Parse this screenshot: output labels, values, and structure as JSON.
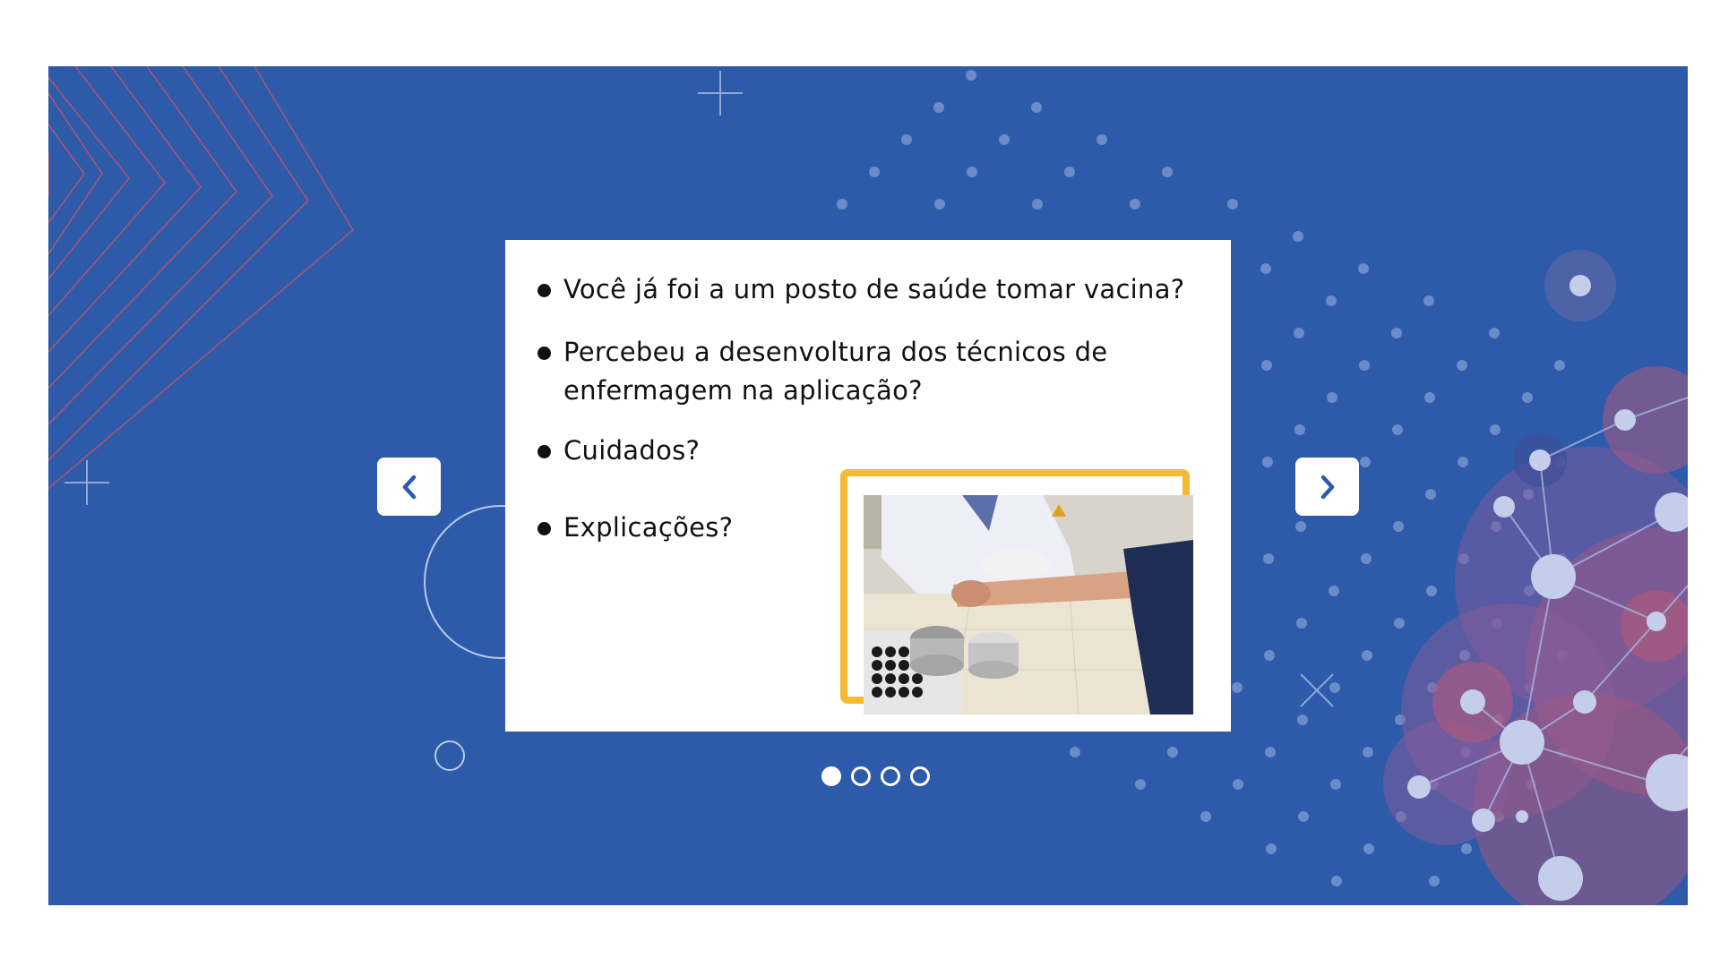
{
  "slide": {
    "bullets": [
      "Você já foi a um posto de saúde tomar vacina?",
      "Percebeu a desenvoltura dos técnicos de enfermagem na aplicação?",
      "Cuidados?",
      "Explicações?"
    ],
    "image": {
      "description_icon": "vaccination-photo"
    }
  },
  "navigation": {
    "prev_icon": "chevron-left-icon",
    "next_icon": "chevron-right-icon"
  },
  "pagination": {
    "total_pages": 4,
    "current_page": 1
  },
  "colors": {
    "background": "#2d5ba9",
    "card": "#ffffff",
    "frame_accent": "#f5b934",
    "nav_arrow": "#2d5ba9",
    "decor_red": "#c2506a",
    "decor_purple": "#8a5c9c"
  }
}
